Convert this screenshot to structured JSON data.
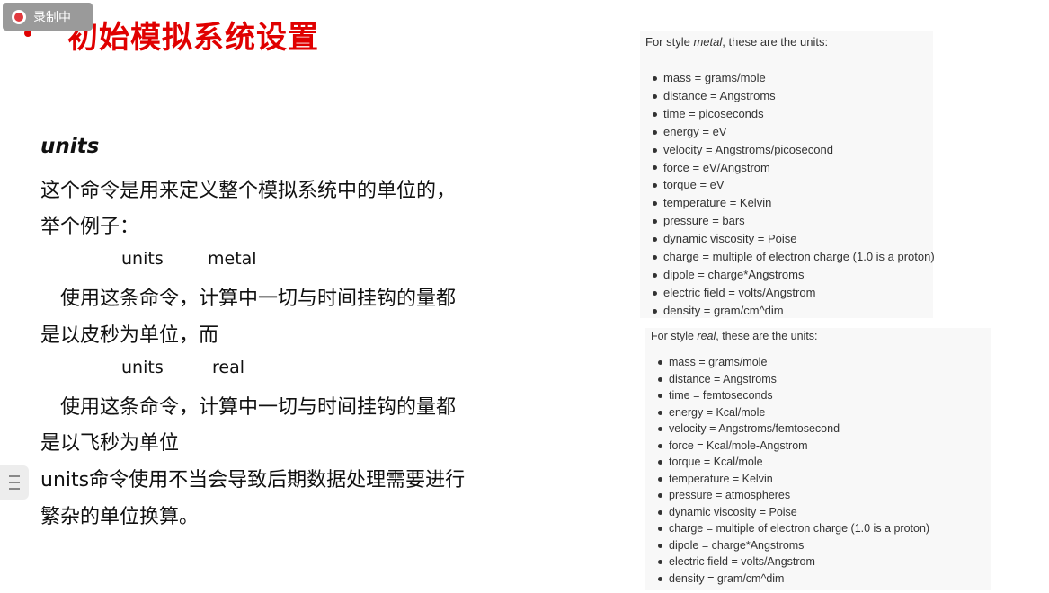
{
  "recording": {
    "label": "录制中"
  },
  "slide": {
    "title": "初始模拟系统设置",
    "units_heading": "units",
    "lines": [
      "这个命令是用来定义整个模拟系统中的单位的，",
      "举个例子：",
      "使用这条命令，计算中一切与时间挂钩的量都",
      "是以皮秒为单位，而",
      "使用这条命令，计算中一切与时间挂钩的量都",
      "是以飞秒为单位",
      "units命令使用不当会导致后期数据处理需要进行",
      "繁杂的单位换算。"
    ],
    "cmd1": [
      "units",
      "metal"
    ],
    "cmd2": [
      "units",
      "real"
    ]
  },
  "metal": {
    "head_pre": "For style ",
    "head_em": "metal",
    "head_post": ", these are the units:",
    "items": [
      "mass = grams/mole",
      "distance = Angstroms",
      "time = picoseconds",
      "energy = eV",
      "velocity = Angstroms/picosecond",
      "force = eV/Angstrom",
      "torque = eV",
      "temperature = Kelvin",
      "pressure = bars",
      "dynamic viscosity = Poise",
      "charge = multiple of electron charge (1.0 is a proton)",
      "dipole = charge*Angstroms",
      "electric field = volts/Angstrom",
      "density = gram/cm^dim"
    ]
  },
  "real": {
    "head_pre": "For style ",
    "head_em": "real",
    "head_post": ", these are the units:",
    "items": [
      "mass = grams/mole",
      "distance = Angstroms",
      "time = femtoseconds",
      "energy = Kcal/mole",
      "velocity = Angstroms/femtosecond",
      "force = Kcal/mole-Angstrom",
      "torque = Kcal/mole",
      "temperature = Kelvin",
      "pressure = atmospheres",
      "dynamic viscosity = Poise",
      "charge = multiple of electron charge (1.0 is a proton)",
      "dipole = charge*Angstroms",
      "electric field = volts/Angstrom",
      "density = gram/cm^dim"
    ]
  }
}
